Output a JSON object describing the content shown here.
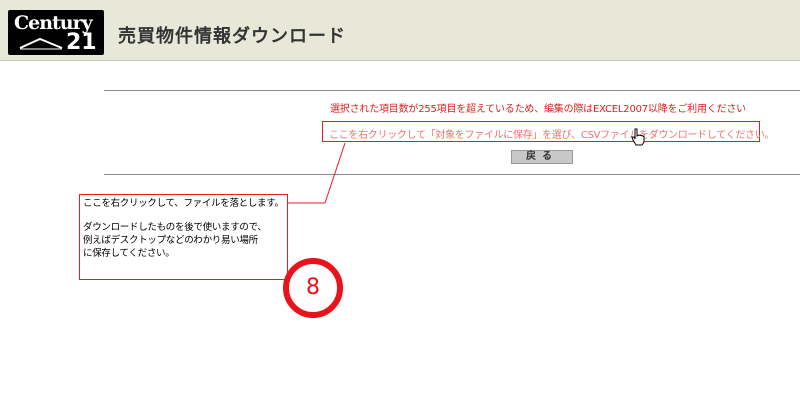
{
  "header": {
    "logo_word": "Century",
    "logo_number": "21",
    "title": "売買物件情報ダウンロード",
    "background_color": "#e8e8d8"
  },
  "notice": {
    "warning": "選択された項目数が255項目を超えているため、編集の際はEXCEL2007以降をご利用ください",
    "instruction": "ここを右クリックして「対象をファイルに保存」を選び、CSVファイルをダウンロードしてください。",
    "warning_color": "#e02020",
    "instruction_color": "#ee7070"
  },
  "back_button": {
    "label": "戻る"
  },
  "callout": {
    "line1": "ここを右クリックして、ファイルを落とします。",
    "line2": "ダウンロードしたものを後で使いますので、",
    "line3": "例えばデスクトップなどのわかり易い場所",
    "line4": "に保存してください。",
    "border_color": "#e02020"
  },
  "step": {
    "number": "8",
    "color": "#e8141c"
  },
  "icons": {
    "cursor": "hand-pointer-icon",
    "logo": "century21-logo"
  }
}
